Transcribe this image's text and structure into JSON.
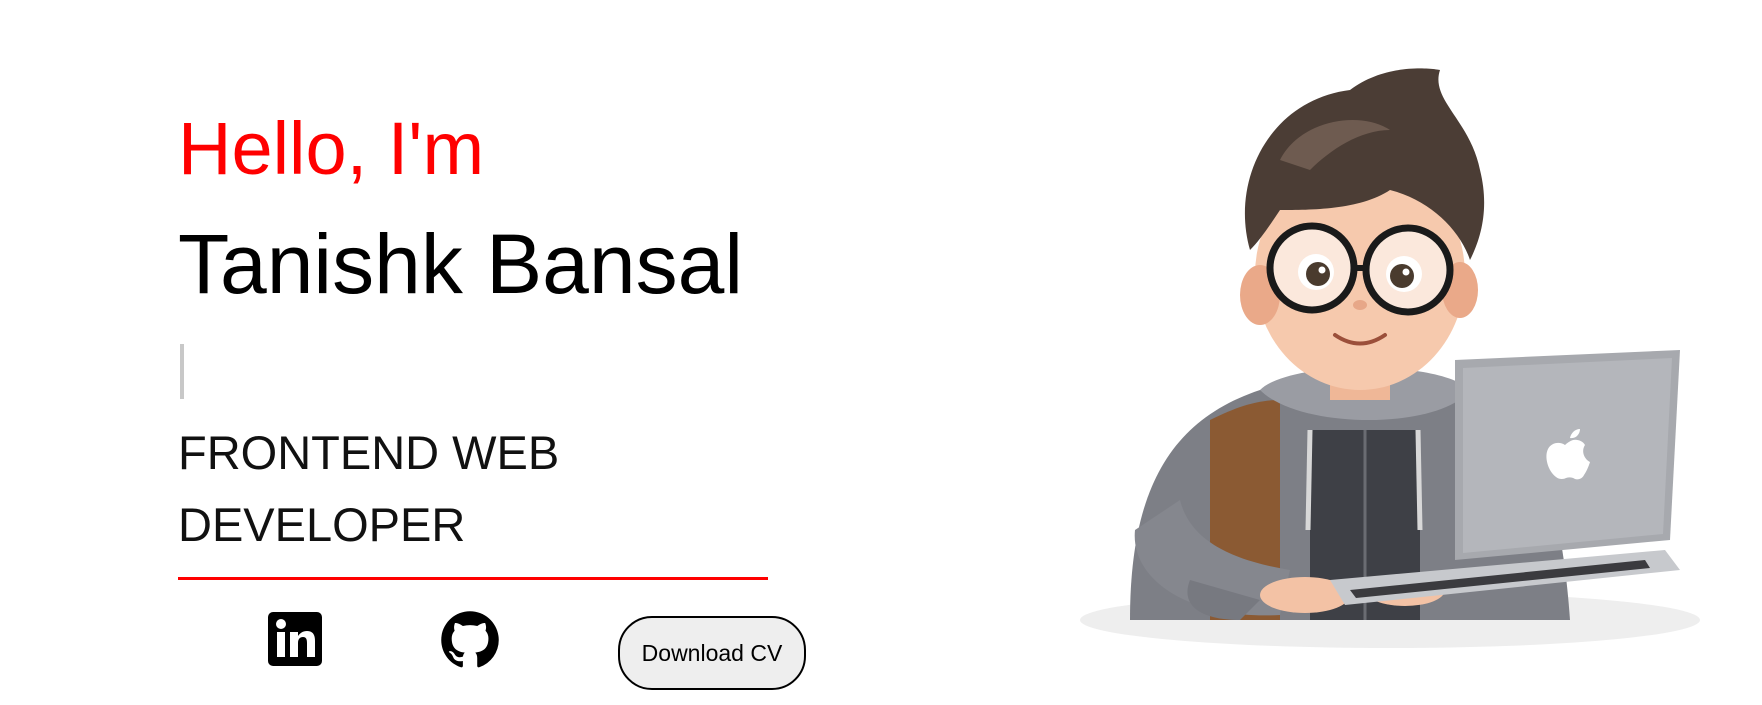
{
  "hero": {
    "greeting": "Hello, I'm",
    "name": "Tanishk Bansal",
    "role": "FRONTEND WEB DEVELOPER"
  },
  "social": {
    "linkedin_icon": "linkedin-icon",
    "github_icon": "github-icon"
  },
  "actions": {
    "download_cv_label": "Download CV"
  },
  "illustration": {
    "subject": "avatar-illustration"
  },
  "colors": {
    "accent": "#ff0000",
    "text": "#000000",
    "button_bg": "#eeeeee",
    "cursor": "#c8c8c8"
  }
}
